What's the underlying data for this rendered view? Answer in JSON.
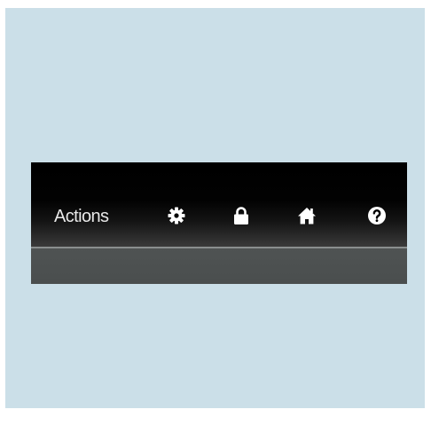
{
  "toolbar": {
    "actions_label": "Actions",
    "icons": [
      "gear-icon",
      "lock-icon",
      "home-icon",
      "help-icon"
    ]
  },
  "colors": {
    "background": "#cbdfe8",
    "toolbar_dark": "#000000",
    "toolbar_lower": "#4f5353",
    "separator": "#8a8f8f",
    "icon": "#ffffff"
  }
}
